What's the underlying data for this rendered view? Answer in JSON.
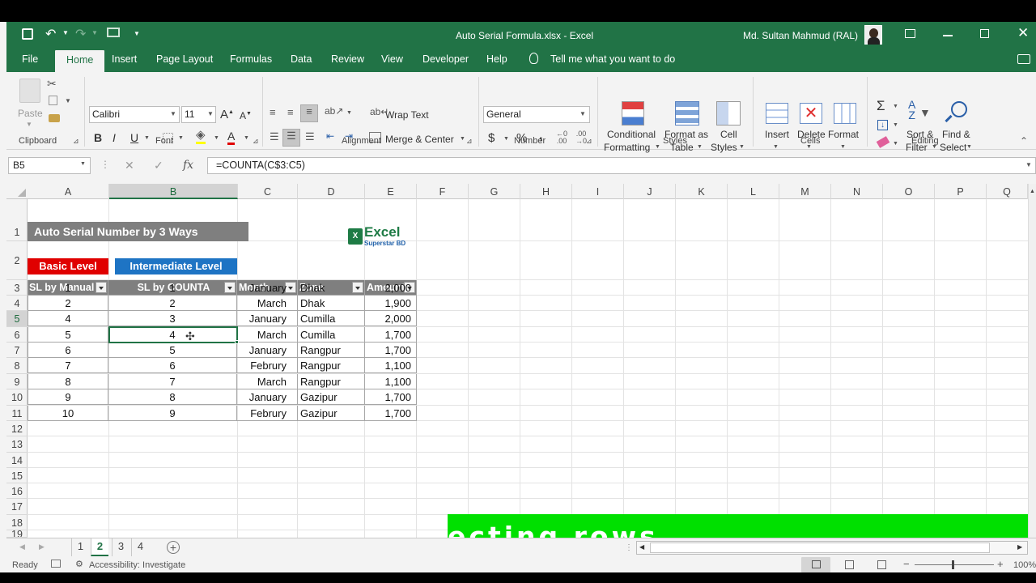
{
  "window": {
    "title": "Auto Serial Formula.xlsx  -  Excel",
    "user": "Md. Sultan Mahmud (RAL)"
  },
  "tabs": [
    "File",
    "Home",
    "Insert",
    "Page Layout",
    "Formulas",
    "Data",
    "Review",
    "View",
    "Developer",
    "Help"
  ],
  "tell_me": "Tell me what you want to do",
  "ribbon": {
    "clipboard": {
      "paste": "Paste",
      "label": "Clipboard"
    },
    "font": {
      "name": "Calibri",
      "size": "11",
      "label": "Font",
      "bold": "B",
      "italic": "I",
      "underline": "U"
    },
    "alignment": {
      "wrap": "Wrap Text",
      "merge": "Merge & Center",
      "label": "Alignment"
    },
    "number": {
      "format": "General",
      "currency": "$",
      "percent": "%",
      "comma": ",",
      "label": "Number"
    },
    "styles": {
      "conditional": "Conditional",
      "conditional2": "Formatting",
      "format_as": "Format as",
      "format_as2": "Table",
      "cell": "Cell",
      "cell2": "Styles",
      "label": "Styles"
    },
    "cells": {
      "insert": "Insert",
      "delete": "Delete",
      "format": "Format",
      "label": "Cells"
    },
    "editing": {
      "sort": "Sort &",
      "sort2": "Filter",
      "find": "Find &",
      "find2": "Select",
      "label": "Editing"
    }
  },
  "formula_bar": {
    "name_box": "B5",
    "fx": "fx",
    "formula": "=COUNTA(C$3:C5)"
  },
  "columns": [
    "A",
    "B",
    "C",
    "D",
    "E",
    "F",
    "G",
    "H",
    "I",
    "J",
    "K",
    "L",
    "M",
    "N",
    "O",
    "P",
    "Q"
  ],
  "rows": [
    "1",
    "2",
    "3",
    "4",
    "5",
    "6",
    "7",
    "8",
    "9",
    "10",
    "11",
    "12",
    "13",
    "14",
    "15",
    "16",
    "17",
    "18",
    "19"
  ],
  "banner": "Auto Serial Number by 3 Ways",
  "logo": {
    "title": "Excel",
    "subtitle": "Superstar BD"
  },
  "buttons": {
    "basic": "Basic Level",
    "intermediate": "Intermediate Level"
  },
  "table": {
    "headers": [
      "SL by Manual",
      "SL by COUNTA",
      "Month",
      "Zone",
      "Amount"
    ],
    "rows": [
      [
        "1",
        "1",
        "January",
        "Dhak",
        "2,000"
      ],
      [
        "2",
        "2",
        "March",
        "Dhak",
        "1,900"
      ],
      [
        "4",
        "3",
        "January",
        "Cumilla",
        "2,000"
      ],
      [
        "5",
        "4",
        "March",
        "Cumilla",
        "1,700"
      ],
      [
        "6",
        "5",
        "January",
        "Rangpur",
        "1,700"
      ],
      [
        "7",
        "6",
        "Februry",
        "Rangpur",
        "1,100"
      ],
      [
        "8",
        "7",
        "March",
        "Rangpur",
        "1,100"
      ],
      [
        "9",
        "8",
        "January",
        "Gazipur",
        "1,700"
      ],
      [
        "10",
        "9",
        "Februry",
        "Gazipur",
        "1,700"
      ]
    ]
  },
  "caption": "ecting rows",
  "sheets": [
    "1",
    "2",
    "3",
    "4"
  ],
  "active_sheet": "2",
  "status": {
    "ready": "Ready",
    "accessibility": "Accessibility: Investigate",
    "zoom": "100%"
  },
  "colors": {
    "excel_green": "#217346",
    "banner_gray": "#7f7f7f",
    "basic_red": "#e00000",
    "intermediate_blue": "#1e74c4",
    "caption_green": "#00e000"
  }
}
